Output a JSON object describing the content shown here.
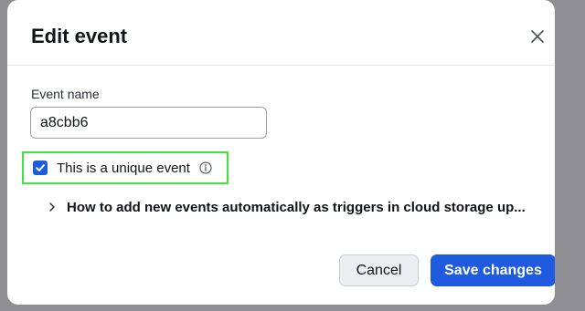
{
  "dialog": {
    "title": "Edit event",
    "close_icon": "close-icon"
  },
  "form": {
    "event_name": {
      "label": "Event name",
      "value": "a8cbb6"
    },
    "unique": {
      "label": "This is a unique event",
      "checked": true,
      "info_icon": "info-icon",
      "checkbox_color": "#1a5fd8",
      "highlight_color": "#3de43d"
    },
    "expander": {
      "label": "How to add new events automatically as triggers in cloud storage up...",
      "icon": "chevron-right-icon"
    }
  },
  "footer": {
    "cancel_label": "Cancel",
    "save_label": "Save changes",
    "save_color": "#1f5ae0"
  }
}
